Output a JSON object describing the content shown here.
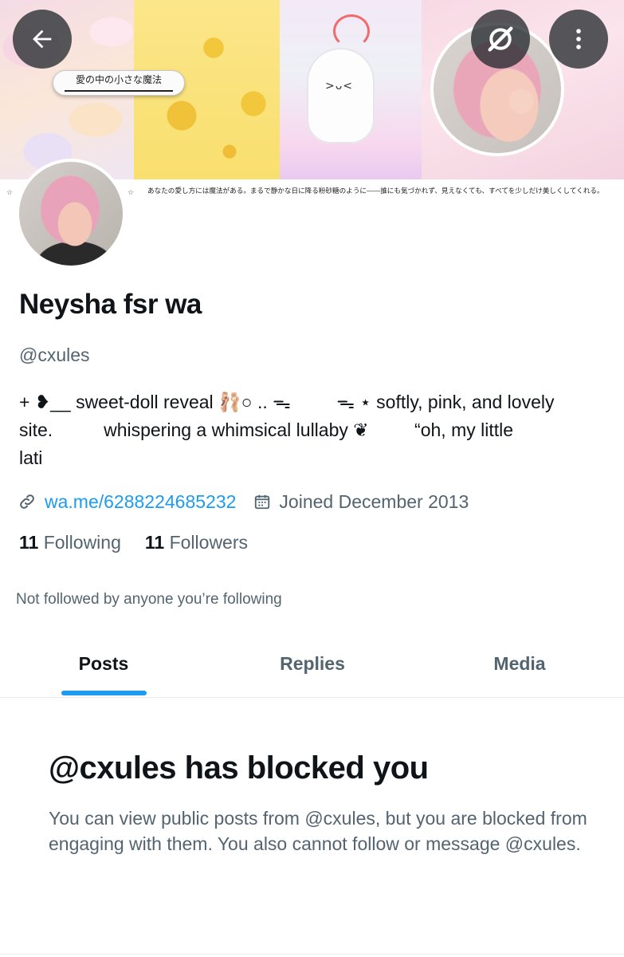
{
  "header": {
    "banner_tag": "愛の中の小さな魔法",
    "banner_quote": "あなたの愛し方には魔法がある。まるで静かな日に降る粉砂糖のように——誰にも気づかれず、見えなくても、すべてを少しだけ美しくしてくれる。",
    "star_glyph": "☆",
    "ghost_face": ">ᴗ<",
    "back_icon": "arrow-left-icon",
    "grok_icon": "grok-icon",
    "more_icon": "more-vertical-icon"
  },
  "profile": {
    "name": "Neysha fsr wa",
    "handle": "@cxules",
    "bio_line1": "+ ❥__ sweet-doll reveal 🩰○ .. ᯓ         ᯓ ⋆ softly, pink, and lovely",
    "bio_line2": "site.          whispering a whimsical lullaby ❦         “oh, my little",
    "bio_line3": "lati",
    "link": "wa.me/6288224685232",
    "joined": "Joined December 2013",
    "following_count": "11",
    "following_label": "Following",
    "followers_count": "11",
    "followers_label": "Followers",
    "not_followed": "Not followed by anyone you’re following"
  },
  "tabs": [
    {
      "label": "Posts",
      "active": true
    },
    {
      "label": "Replies",
      "active": false
    },
    {
      "label": "Media",
      "active": false
    }
  ],
  "blocked": {
    "title": "@cxules has blocked you",
    "body": "You can view public posts from @cxules, but you are blocked from engaging with them. You also cannot follow or message @cxules."
  },
  "colors": {
    "accent": "#1d9bf0",
    "text_primary": "#0f1419",
    "text_secondary": "#536471"
  }
}
